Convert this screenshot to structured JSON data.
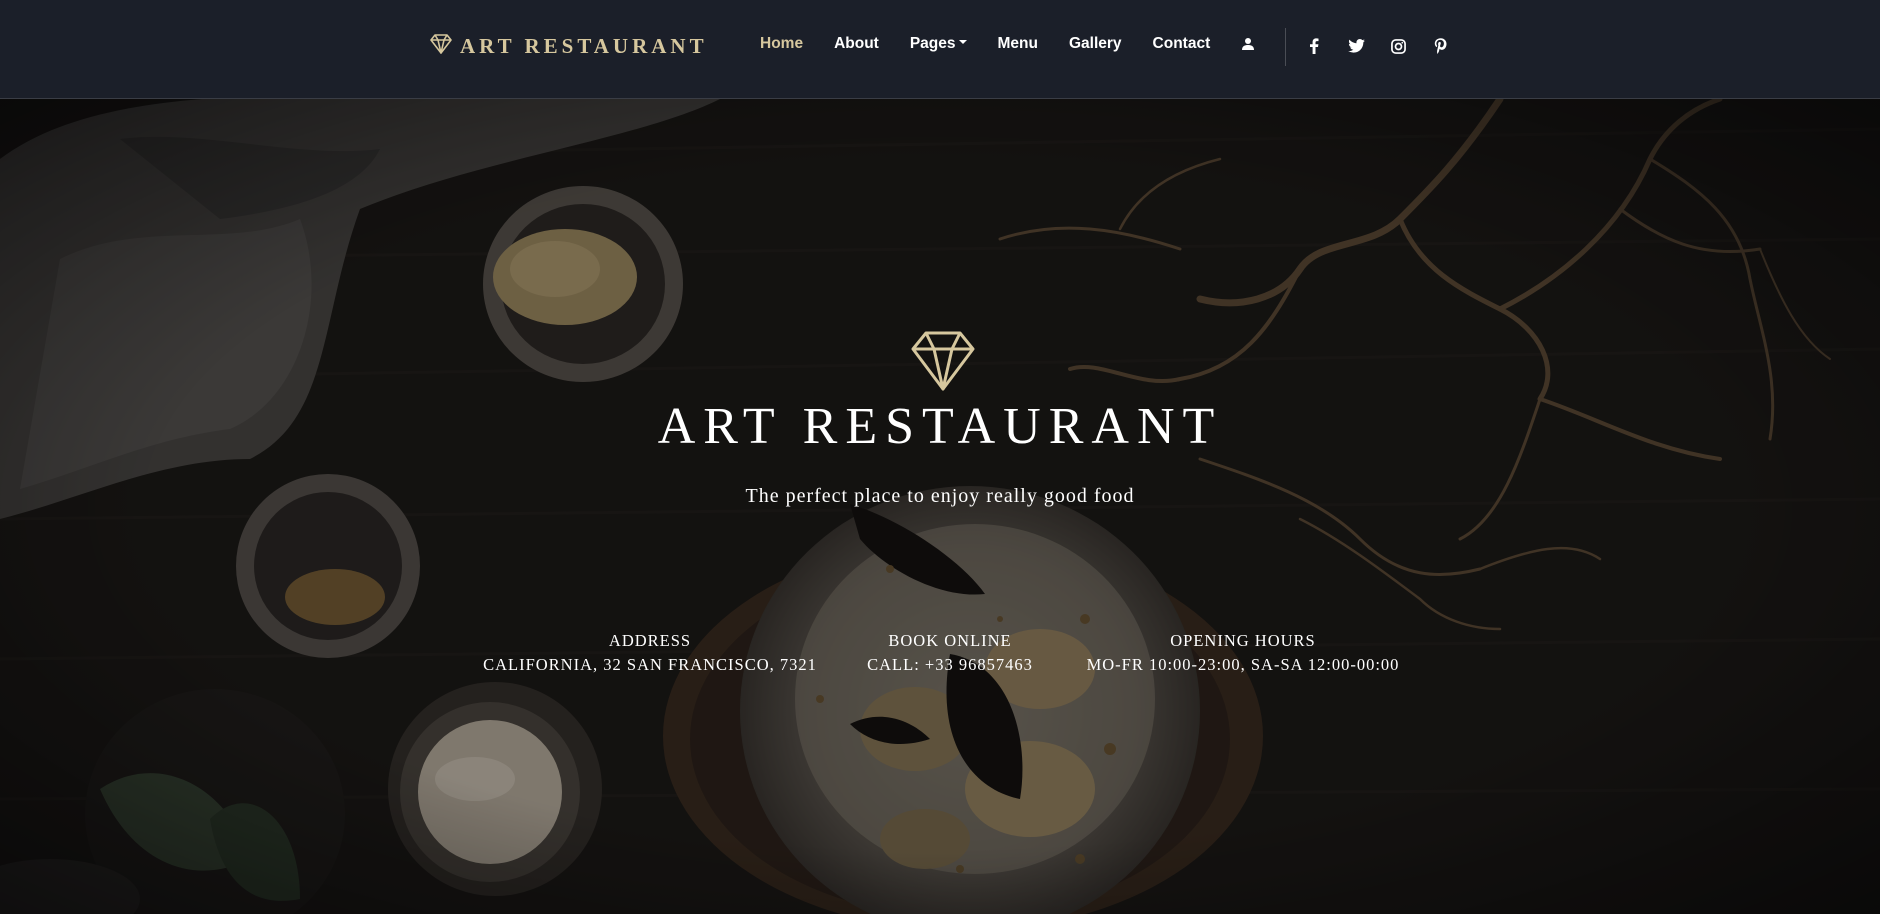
{
  "header": {
    "brand": "ART RESTAURANT",
    "nav": [
      {
        "label": "Home",
        "active": true
      },
      {
        "label": "About"
      },
      {
        "label": "Pages",
        "dropdown": true
      },
      {
        "label": "Menu"
      },
      {
        "label": "Gallery"
      },
      {
        "label": "Contact"
      }
    ],
    "icons": [
      "diamond-icon",
      "user-icon",
      "facebook-icon",
      "twitter-icon",
      "instagram-icon",
      "pinterest-icon"
    ]
  },
  "hero": {
    "title": "ART RESTAURANT",
    "subtitle": "The perfect place to enjoy really good food",
    "info": [
      {
        "label": "ADDRESS",
        "value": "CALIFORNIA, 32 SAN FRANCISCO, 7321"
      },
      {
        "label": "BOOK ONLINE",
        "value": "CALL: +33 96857463"
      },
      {
        "label": "OPENING HOURS",
        "value": "MO-FR 10:00-23:00, SA-SA 12:00-00:00"
      }
    ]
  },
  "colors": {
    "accent": "#d6c79e",
    "navbar": "#1b1f29",
    "text": "#ffffff"
  }
}
